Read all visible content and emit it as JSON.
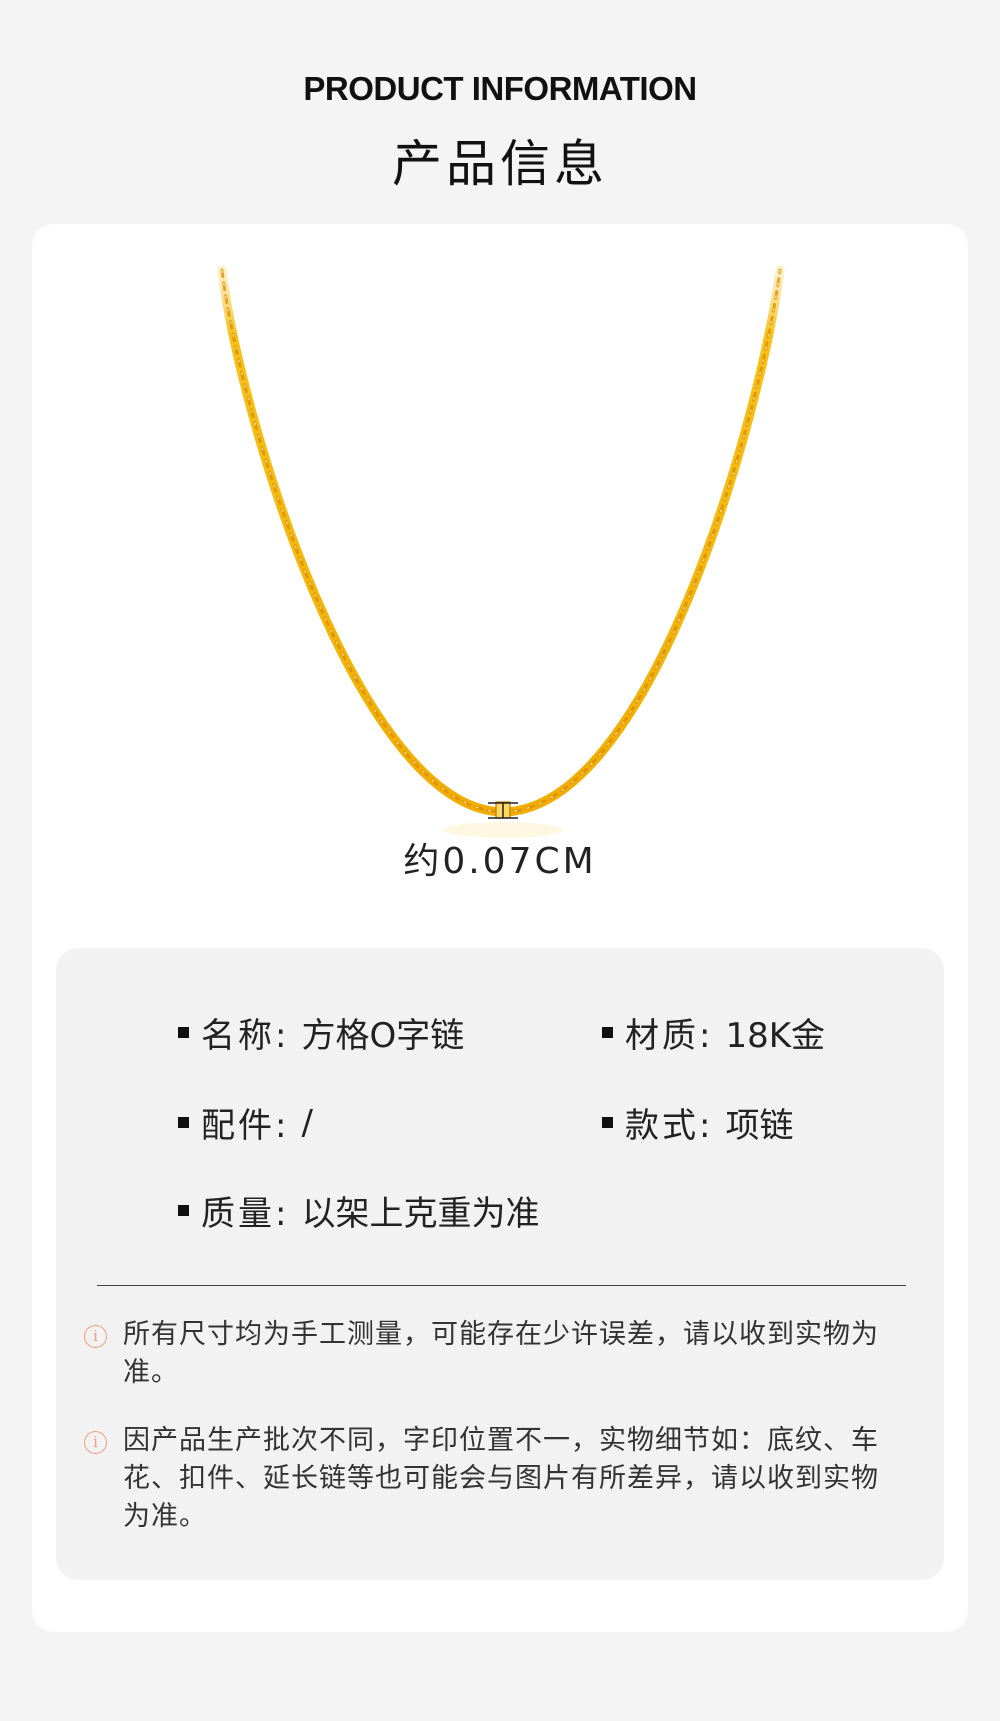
{
  "header": {
    "title_en": "PRODUCT INFORMATION",
    "title_cn": "产品信息"
  },
  "product": {
    "chain_width_label": "约0.07CM"
  },
  "specs": {
    "name": {
      "label": "名称:",
      "value": "方格O字链"
    },
    "material": {
      "label": "材质:",
      "value": "18K金"
    },
    "accessory": {
      "label": "配件:",
      "value": "/"
    },
    "style": {
      "label": "款式:",
      "value": "项链"
    },
    "weight": {
      "label": "质量:",
      "value": "以架上克重为准"
    }
  },
  "notes": [
    "所有尺寸均为手工测量，可能存在少许误差，请以收到实物为准。",
    "因产品生产批次不同，字印位置不一，实物细节如：底纹、车花、扣件、延长链等也可能会与图片有所差异，请以收到实物为准。"
  ],
  "colors": {
    "gold": "#f5b800",
    "gold_dark": "#e39a00",
    "info_icon": "#f0a080",
    "background": "#f4f4f4"
  },
  "icons": {
    "info": "info-circle-icon",
    "bullet": "square-bullet-icon"
  }
}
